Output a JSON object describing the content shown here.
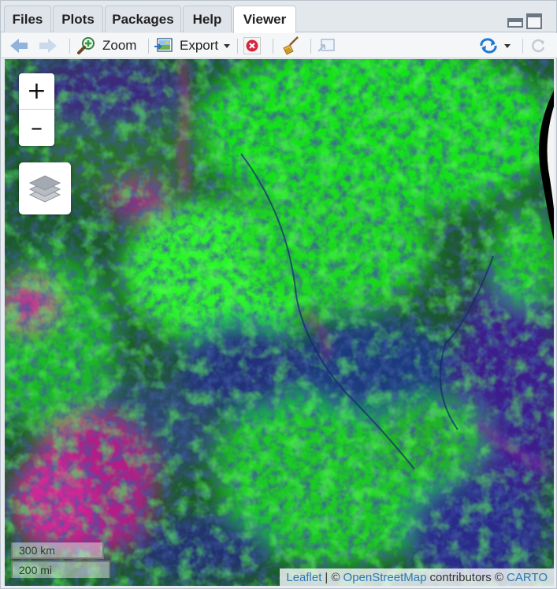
{
  "tabs": [
    {
      "label": "Files"
    },
    {
      "label": "Plots"
    },
    {
      "label": "Packages"
    },
    {
      "label": "Help"
    },
    {
      "label": "Viewer"
    }
  ],
  "toolbar": {
    "zoom_label": "Zoom",
    "export_label": "Export"
  },
  "map": {
    "zoom_in": "+",
    "zoom_out": "–",
    "scale_km": "300 km",
    "scale_mi": "200 mi",
    "attribution": {
      "leaflet": "Leaflet",
      "sep": "| ©",
      "osm": "OpenStreetMap",
      "contrib": "contributors ©",
      "carto": "CARTO"
    }
  },
  "colors": {
    "link": "#2a78b5",
    "vegetation_bright": "#22ff22",
    "vegetation_dark": "#1b3a70",
    "magenta": "#c0208a"
  }
}
